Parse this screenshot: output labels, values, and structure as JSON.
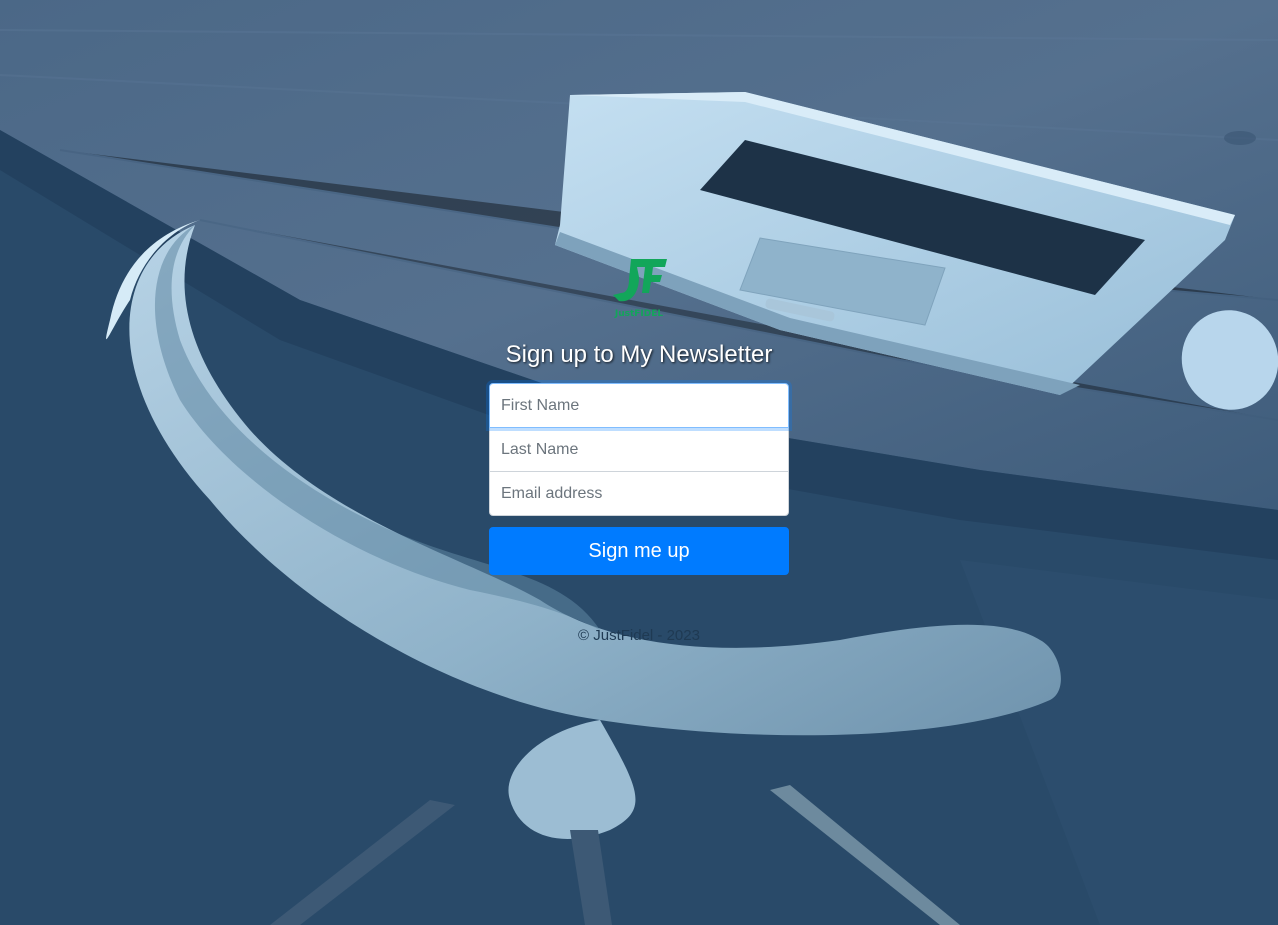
{
  "brand": {
    "logo_text": "JustFIDEL",
    "logo_color": "#12a65a"
  },
  "form": {
    "heading": "Sign up to My Newsletter",
    "first_name_placeholder": "First Name",
    "last_name_placeholder": "Last Name",
    "email_placeholder": "Email address",
    "submit_label": "Sign me up"
  },
  "footer": {
    "copyright": "© JustFidel - 2023"
  },
  "theme": {
    "overlay": "#294a69",
    "primary": "#007bff"
  }
}
